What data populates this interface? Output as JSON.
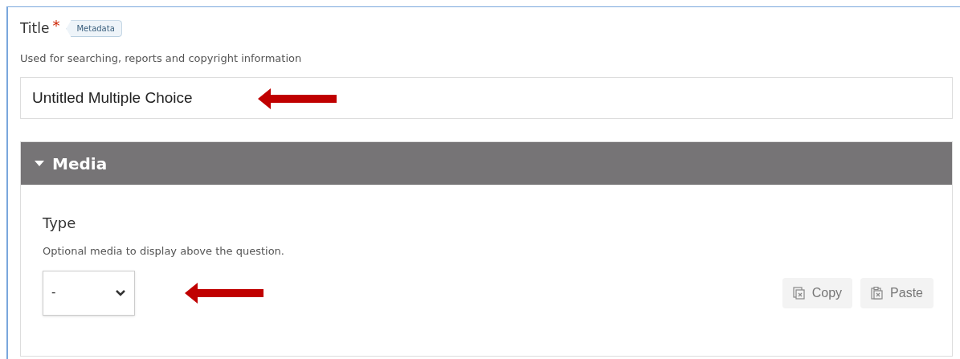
{
  "title_field": {
    "label": "Title",
    "required_mark": "*",
    "tag": "Metadata",
    "help": "Used for searching, reports and copyright information",
    "value": "Untitled Multiple Choice"
  },
  "media_section": {
    "heading": "Media",
    "expanded": true,
    "type_field": {
      "label": "Type",
      "help": "Optional media to display above the question.",
      "value": "-"
    },
    "buttons": [
      {
        "label": "Copy",
        "kind": "copy"
      },
      {
        "label": "Paste",
        "kind": "paste"
      }
    ]
  }
}
